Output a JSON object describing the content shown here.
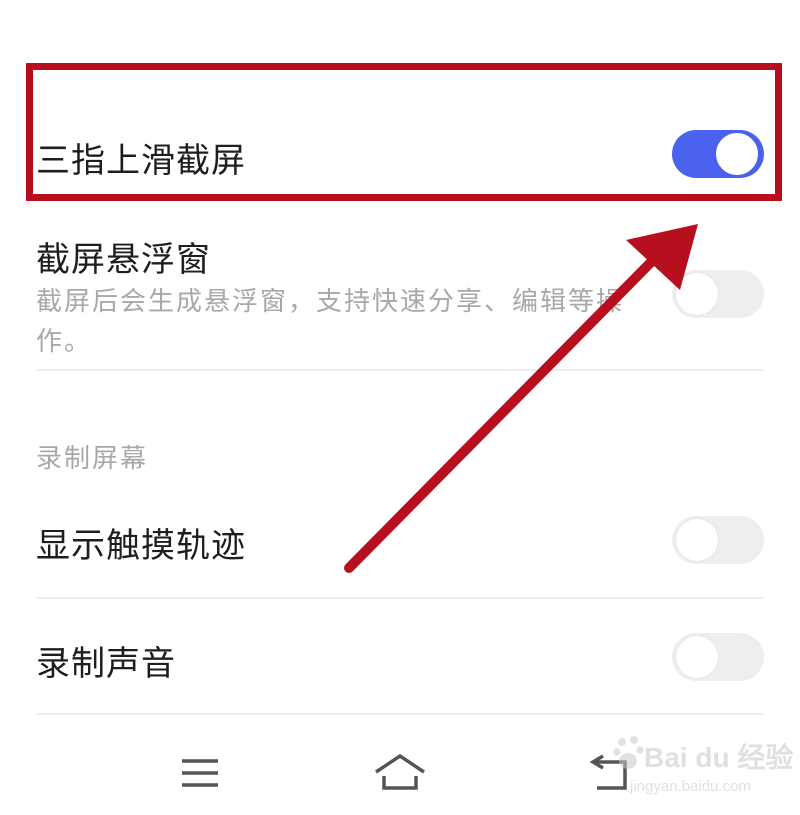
{
  "settings": {
    "three_finger_screenshot": {
      "label": "三指上滑截屏",
      "enabled": true
    },
    "floating_window": {
      "label": "截屏悬浮窗",
      "description": "截屏后会生成悬浮窗，支持快速分享、编辑等操作。",
      "enabled": false
    }
  },
  "screen_recording": {
    "header": "录制屏幕",
    "show_touches": {
      "label": "显示触摸轨迹",
      "enabled": false
    },
    "record_sound": {
      "label": "录制声音",
      "enabled": false
    }
  },
  "navbar": {
    "icons": [
      "menu-icon",
      "home-icon",
      "back-icon"
    ]
  },
  "watermark": {
    "brand": "Bai du 经验",
    "url": "jingyan.baidu.com"
  },
  "colors": {
    "toggle_on": "#4b62ef",
    "toggle_off": "#eeeeee",
    "annotation_red": "#b80f1e",
    "secondary_text": "#a8a8a8"
  }
}
